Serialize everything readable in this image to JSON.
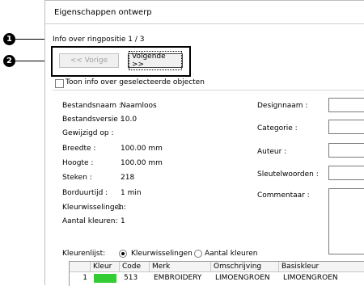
{
  "callouts": [
    "1",
    "2"
  ],
  "dialog": {
    "title": "Eigenschappen ontwerp",
    "info_line": "Info over ringpositie 1 / 3",
    "prev_button": "<< Vorige",
    "next_button": "Volgende >>",
    "show_selected_label": "Toon info over geselecteerde objecten",
    "show_selected_checked": false
  },
  "properties": [
    {
      "label": "Bestandsnaam :",
      "value": "Naamloos"
    },
    {
      "label": "Bestandsversie :",
      "value": "10.0"
    },
    {
      "label": "Gewijzigd op :",
      "value": ""
    },
    {
      "label": "Breedte :",
      "value": "100.00 mm"
    },
    {
      "label": "Hoogte :",
      "value": "100.00 mm"
    },
    {
      "label": "Steken :",
      "value": "218"
    },
    {
      "label": "Borduurtijd :",
      "value": "1 min"
    },
    {
      "label": "Kleurwisselingen:",
      "value": "1"
    },
    {
      "label": "Aantal kleuren:",
      "value": "1"
    }
  ],
  "right_fields": [
    {
      "label": "Designnaam :",
      "value": ""
    },
    {
      "label": "Categorie :",
      "value": ""
    },
    {
      "label": "Auteur :",
      "value": ""
    },
    {
      "label": "Sleutelwoorden :",
      "value": ""
    }
  ],
  "comment_label": "Commentaar :",
  "color_list": {
    "label": "Kleurenlijst:",
    "options": [
      "Kleurwisselingen",
      "Aantal kleuren"
    ],
    "selected": "Kleurwisselingen"
  },
  "table": {
    "headers": [
      "Kleur",
      "Code",
      "Merk",
      "Omschrijving",
      "Basiskleur"
    ],
    "rows": [
      {
        "index": "1",
        "color": "#33cc33",
        "code": "513",
        "brand": "EMBROIDERY",
        "description": "LIMOENGROEN",
        "base": "LIMOENGROEN"
      }
    ]
  }
}
